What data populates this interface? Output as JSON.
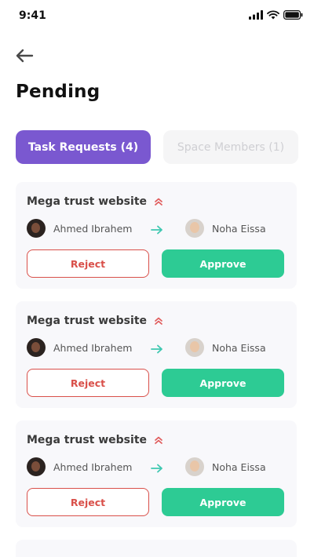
{
  "status_bar": {
    "time": "9:41"
  },
  "header": {
    "title": "Pending"
  },
  "tabs": [
    {
      "label": "Task Requests (4)",
      "active": true
    },
    {
      "label": "Space Members (1)",
      "active": false
    }
  ],
  "cards": [
    {
      "title": "Mega trust website",
      "from": "Ahmed Ibrahem",
      "to": "Noha Eissa",
      "reject_label": "Reject",
      "approve_label": "Approve"
    },
    {
      "title": "Mega trust website",
      "from": "Ahmed Ibrahem",
      "to": "Noha Eissa",
      "reject_label": "Reject",
      "approve_label": "Approve"
    },
    {
      "title": "Mega trust website",
      "from": "Ahmed Ibrahem",
      "to": "Noha Eissa",
      "reject_label": "Reject",
      "approve_label": "Approve"
    }
  ],
  "icons": {
    "back": "arrow-left-icon",
    "priority": "double-chevron-up-icon",
    "assign": "arrow-right-icon"
  },
  "colors": {
    "accent": "#7a58d0",
    "approve": "#2dcb94",
    "reject": "#d9504a",
    "priority": "#e05a5a",
    "arrow": "#3ec7b0"
  }
}
